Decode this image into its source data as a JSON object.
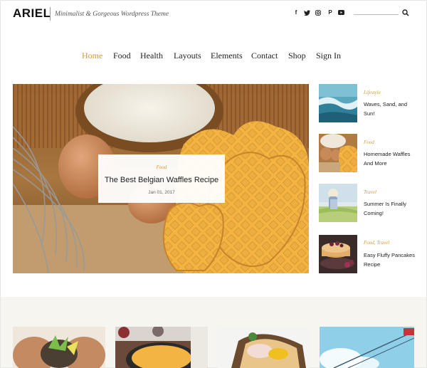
{
  "header": {
    "logo": "ARIEL",
    "tagline": "Minimalist & Gorgeous Wordpress Theme",
    "social_icons": [
      "facebook-icon",
      "twitter-icon",
      "instagram-icon",
      "pinterest-icon",
      "youtube-icon"
    ],
    "social_glyphs": [
      "f",
      "t",
      "◎",
      "P",
      "▶"
    ]
  },
  "nav": {
    "items": [
      {
        "label": "Home",
        "active": true
      },
      {
        "label": "Food"
      },
      {
        "label": "Health"
      },
      {
        "label": "Layouts"
      },
      {
        "label": "Elements"
      },
      {
        "label": "Contact"
      },
      {
        "label": "Shop"
      },
      {
        "label": "Sign In"
      }
    ]
  },
  "hero": {
    "category": "Food",
    "title": "The Best Belgian Waffles Recipe",
    "date": "Jan 01, 2017"
  },
  "side_posts": [
    {
      "category": "Lifestyle",
      "title_lines": [
        "Waves, Sand, and",
        "Sun!"
      ]
    },
    {
      "category": "Food",
      "title_lines": [
        "Homemade Waffles",
        "And More"
      ]
    },
    {
      "category": "Travel",
      "title_lines": [
        "Summer Is Finally",
        "Coming!"
      ]
    },
    {
      "category": "Food, Travel",
      "title_lines": [
        "Easy Fluffy Pancakes",
        "Recipe"
      ]
    }
  ],
  "colors": {
    "accent": "#d39a37",
    "text": "#222222",
    "band": "#f7f5f0"
  }
}
